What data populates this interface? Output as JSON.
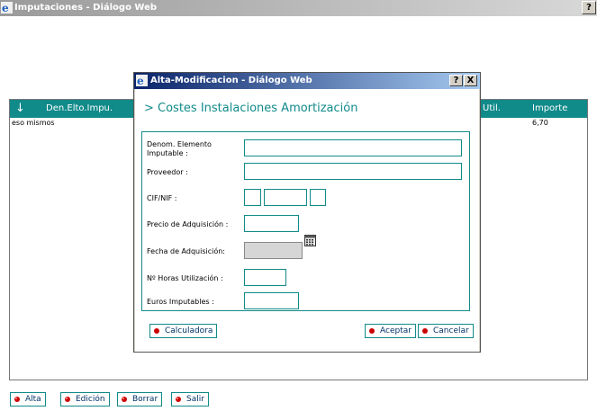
{
  "outer_window": {
    "title": "Imputaciones - Diálogo Web",
    "help_label": "?"
  },
  "grid": {
    "columns": [
      "Den.Elto.Impu.",
      "Util.",
      "Importe"
    ],
    "rows": [
      {
        "den": "eso mismos",
        "importe": "6,70"
      }
    ]
  },
  "outer_buttons": {
    "alta": "Alta",
    "edicion": "Edición",
    "borrar": "Borrar",
    "salir": "Salir"
  },
  "dialog": {
    "title": "Alta-Modificacion - Diálogo Web",
    "help_label": "?",
    "close_label": "X",
    "section_title": "> Costes Instalaciones Amortización",
    "fields": {
      "denom_label_1": "Denom. Elemento",
      "denom_label_2": "Imputable :",
      "denom_value": "",
      "proveedor_label": "Proveedor :",
      "proveedor_value": "",
      "cif_label": "CIF/NIF :",
      "precio_label": "Precio de Adquisición :",
      "precio_value": "",
      "fecha_label": "Fecha de Adquisición:",
      "fecha_value": "",
      "horas_label": "Nº Horas Utilización :",
      "horas_value": "",
      "euros_label": "Euros Imputables :",
      "euros_value": ""
    },
    "buttons": {
      "calculadora": "Calculadora",
      "aceptar": "Aceptar",
      "cancelar": "Cancelar"
    }
  },
  "colors": {
    "accent": "#118a8a",
    "dialog_title": "#0a246a",
    "button_dot": "#cc0000"
  }
}
